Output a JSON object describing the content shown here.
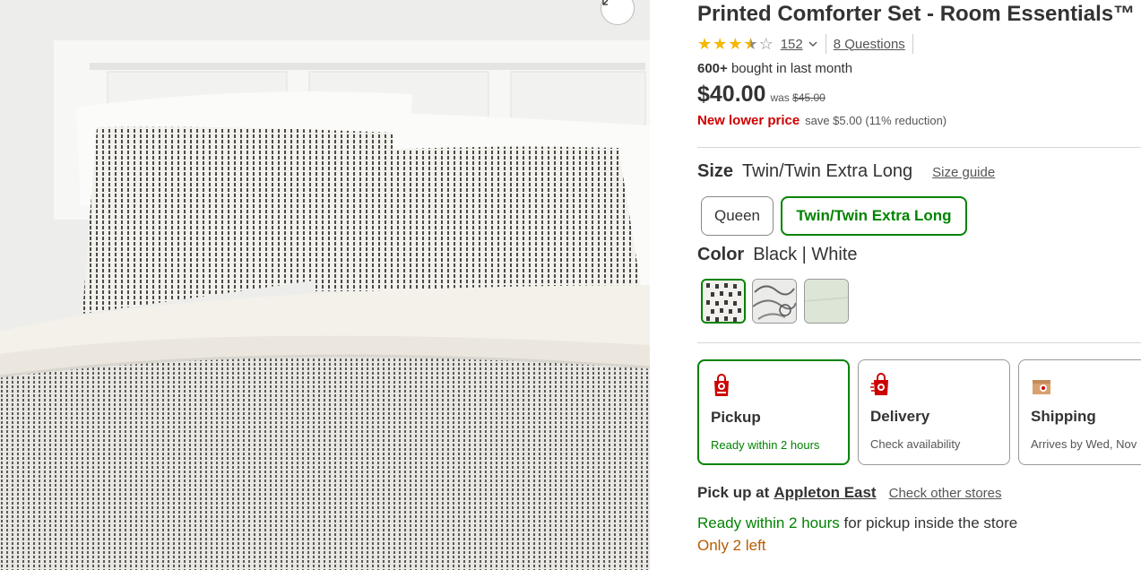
{
  "product": {
    "title": "Printed Comforter Set - Room Essentials™",
    "rating": {
      "value": 3.5,
      "max": 5,
      "review_count": "152",
      "questions": "8 Questions"
    },
    "bought": {
      "count": "600+",
      "text": "bought in last month"
    },
    "price": {
      "current": "$40.00",
      "was_label": "was",
      "was_price": "$45.00"
    },
    "promo": {
      "label": "New lower price",
      "save_text": "save $5.00 (11% reduction)"
    }
  },
  "size": {
    "label": "Size",
    "selected": "Twin/Twin Extra Long",
    "guide_link": "Size guide",
    "options": [
      "Queen",
      "Twin/Twin Extra Long"
    ]
  },
  "color": {
    "label": "Color",
    "selected": "Black | White",
    "swatches": [
      "black-white-dash",
      "gray-floral",
      "sage-green"
    ]
  },
  "fulfillment": [
    {
      "name": "Pickup",
      "sub": "Ready within 2 hours",
      "icon": "pickup-bag-icon",
      "selected": true
    },
    {
      "name": "Delivery",
      "sub": "Check availability",
      "icon": "delivery-bag-icon",
      "selected": false
    },
    {
      "name": "Shipping",
      "sub": "Arrives by Wed, Nov",
      "icon": "shipping-box-icon",
      "selected": false
    }
  ],
  "pickup": {
    "label": "Pick up at",
    "store": "Appleton East",
    "other_link": "Check other stores",
    "ready_green": "Ready within 2 hours",
    "ready_rest": " for pickup inside the store",
    "stock": "Only 2 left"
  },
  "colors": {
    "green": "#008300",
    "red": "#cc0000",
    "star": "#f5b700",
    "orange": "#b85c00"
  }
}
